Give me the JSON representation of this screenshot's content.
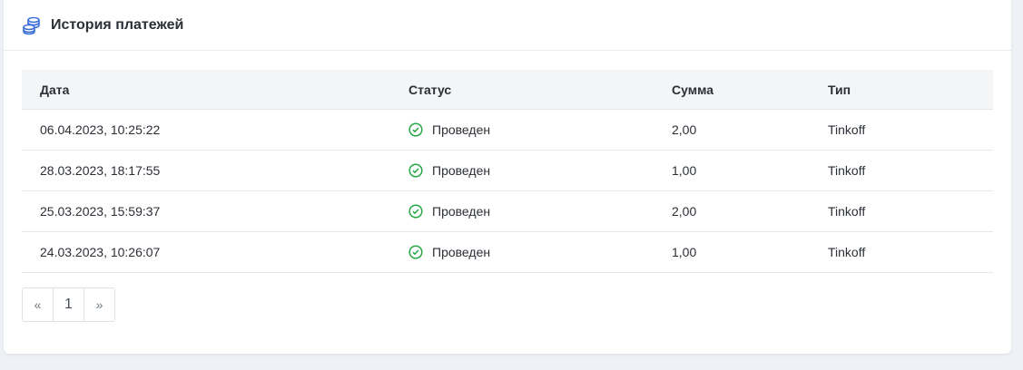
{
  "header": {
    "title": "История платежей",
    "icon": "coins-icon"
  },
  "table": {
    "columns": [
      "Дата",
      "Статус",
      "Сумма",
      "Тип"
    ],
    "rows": [
      {
        "date": "06.04.2023, 10:25:22",
        "status": "Проведен",
        "sum": "2,00",
        "type": "Tinkoff"
      },
      {
        "date": "28.03.2023, 18:17:55",
        "status": "Проведен",
        "sum": "1,00",
        "type": "Tinkoff"
      },
      {
        "date": "25.03.2023, 15:59:37",
        "status": "Проведен",
        "sum": "2,00",
        "type": "Tinkoff"
      },
      {
        "date": "24.03.2023, 10:26:07",
        "status": "Проведен",
        "sum": "1,00",
        "type": "Tinkoff"
      }
    ]
  },
  "pagination": {
    "prev": "«",
    "page": "1",
    "next": "»"
  },
  "colors": {
    "accent": "#3d6fd9",
    "success": "#28a745",
    "header_bg": "#f4f5f7"
  }
}
